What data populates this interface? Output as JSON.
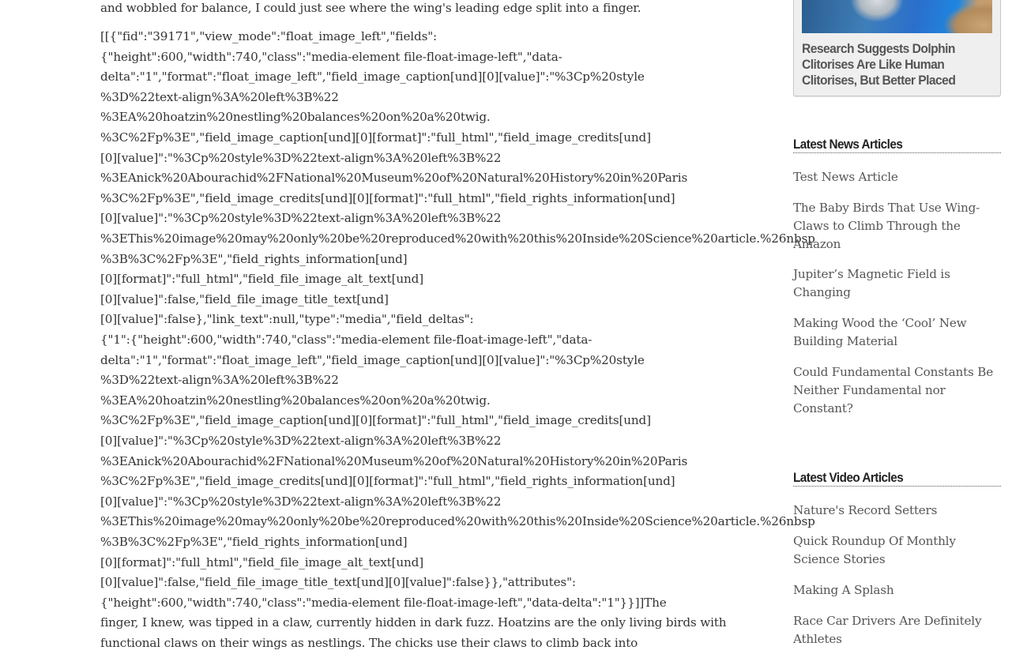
{
  "article": {
    "lines": [
      "and wobbled for balance, I could just see where the wing's leading edge split into a finger.",
      "[[{\"fid\":\"39171\",\"view_mode\":\"float_image_left\",\"fields\":",
      "{\"height\":600,\"width\":740,\"class\":\"media-element file-float-image-left\",\"data-",
      "delta\":\"1\",\"format\":\"float_image_left\",\"field_image_caption[und][0][value]\":\"%3Cp%20style",
      "%3D%22text-align%3A%20left%3B%22",
      "%3EA%20hoatzin%20nestling%20balances%20on%20a%20twig.",
      "%3C%2Fp%3E\",\"field_image_caption[und][0][format]\":\"full_html\",\"field_image_credits[und]",
      "[0][value]\":\"%3Cp%20style%3D%22text-align%3A%20left%3B%22",
      "%3EAnick%20Abourachid%2FNational%20Museum%20of%20Natural%20History%20in%20Paris",
      "%3C%2Fp%3E\",\"field_image_credits[und][0][format]\":\"full_html\",\"field_rights_information[und]",
      "[0][value]\":\"%3Cp%20style%3D%22text-align%3A%20left%3B%22",
      "%3EThis%20image%20may%20only%20be%20reproduced%20with%20this%20Inside%20Science%20article.%26nbsp",
      "%3B%3C%2Fp%3E\",\"field_rights_information[und]",
      "[0][format]\":\"full_html\",\"field_file_image_alt_text[und]",
      "[0][value]\":false,\"field_file_image_title_text[und]",
      "[0][value]\":false},\"link_text\":null,\"type\":\"media\",\"field_deltas\":",
      "{\"1\":{\"height\":600,\"width\":740,\"class\":\"media-element file-float-image-left\",\"data-",
      "delta\":\"1\",\"format\":\"float_image_left\",\"field_image_caption[und][0][value]\":\"%3Cp%20style",
      "%3D%22text-align%3A%20left%3B%22",
      "%3EA%20hoatzin%20nestling%20balances%20on%20a%20twig.",
      "%3C%2Fp%3E\",\"field_image_caption[und][0][format]\":\"full_html\",\"field_image_credits[und]",
      "[0][value]\":\"%3Cp%20style%3D%22text-align%3A%20left%3B%22",
      "%3EAnick%20Abourachid%2FNational%20Museum%20of%20Natural%20History%20in%20Paris",
      "%3C%2Fp%3E\",\"field_image_credits[und][0][format]\":\"full_html\",\"field_rights_information[und]",
      "[0][value]\":\"%3Cp%20style%3D%22text-align%3A%20left%3B%22",
      "%3EThis%20image%20may%20only%20be%20reproduced%20with%20this%20Inside%20Science%20article.%26nbsp",
      "%3B%3C%2Fp%3E\",\"field_rights_information[und]",
      "[0][format]\":\"full_html\",\"field_file_image_alt_text[und]",
      "[0][value]\":false,\"field_file_image_title_text[und][0][value]\":false}},\"attributes\":",
      "{\"height\":600,\"width\":740,\"class\":\"media-element file-float-image-left\",\"data-delta\":\"1\"}}]]The",
      "finger, I knew, was tipped in a claw, currently hidden in dark fuzz. Hoatzins are the only living birds with",
      "functional claws on their wings as nestlings. The chicks use their claws to climb back into"
    ]
  },
  "sidebar": {
    "featured": {
      "image_alt": "dolphin-photo",
      "title_lines": [
        "Research Suggests Dolphin",
        "Clitorises Are Like Human",
        "Clitorises, But Better Placed"
      ]
    },
    "news": {
      "heading": "Latest News Articles",
      "items": [
        {
          "lines": [
            "Test News Article"
          ]
        },
        {
          "lines": [
            "The Baby Birds That Use Wing-",
            "Claws to Climb Through the",
            "Amazon"
          ]
        },
        {
          "lines": [
            "Jupiter’s Magnetic Field is",
            "Changing"
          ]
        },
        {
          "lines": [
            "Making Wood the ‘Cool’ New",
            "Building Material"
          ]
        },
        {
          "lines": [
            "Could Fundamental Constants Be",
            "Neither Fundamental nor",
            "Constant?"
          ]
        }
      ]
    },
    "video": {
      "heading": "Latest Video Articles",
      "items": [
        {
          "lines": [
            "Nature's Record Setters"
          ]
        },
        {
          "lines": [
            "Quick Roundup Of Monthly",
            "Science Stories"
          ]
        },
        {
          "lines": [
            "Making A Splash"
          ]
        },
        {
          "lines": [
            "Race Car Drivers Are Definitely",
            "Athletes"
          ]
        }
      ]
    }
  }
}
